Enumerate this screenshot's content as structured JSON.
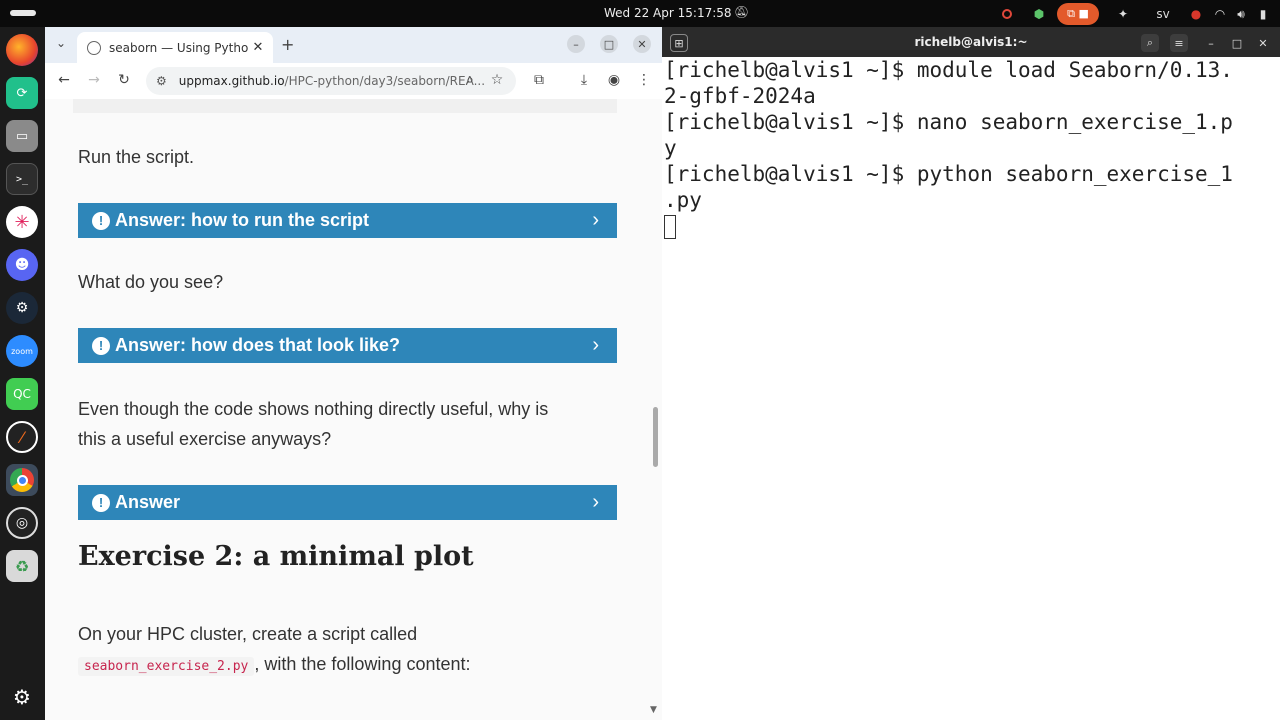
{
  "topbar": {
    "clock": "Wed 22 Apr  15:17:58",
    "keyboard_layout": "sv"
  },
  "dock": {
    "apps": [
      "firefox-icon",
      "pycharm-icon",
      "files-icon",
      "terminal-icon",
      "slack-icon",
      "discord-icon",
      "steam-icon",
      "zoom-icon",
      "qt-creator-icon",
      "pdf-icon",
      "chrome-icon",
      "obs-icon",
      "trash-icon",
      "apps-grid-icon"
    ],
    "zoom_label": "zoom",
    "qt_label": "QC"
  },
  "browser": {
    "tab_title": "seaborn — Using Python",
    "url_host": "uppmax.github.io",
    "url_path": "/HPC-python/day3/seaborn/REA..."
  },
  "page": {
    "para1": "Run the script.",
    "admon1": "Answer: how to run the script",
    "para2": "What do you see?",
    "admon2": "Answer: how does that look like?",
    "para3_line1": "Even though the code shows nothing directly useful, why is",
    "para3_line2": "this a useful exercise anyways?",
    "admon3": "Answer",
    "heading": "Exercise 2: a minimal plot",
    "para4_line1": "On your HPC cluster, create a script called",
    "para4_code": "seaborn_exercise_2.py",
    "para4_rest": ", with the following content:"
  },
  "terminal": {
    "title": "richelb@alvis1:~",
    "lines": [
      "[richelb@alvis1 ~]$ module load Seaborn/0.13.",
      "2-gfbf-2024a",
      "[richelb@alvis1 ~]$ nano seaborn_exercise_1.p",
      "y",
      "[richelb@alvis1 ~]$ python seaborn_exercise_1",
      ".py"
    ]
  },
  "colors": {
    "admonition": "#2e86b9",
    "terminal_bg": "#ffffff",
    "topbar_bg": "#0b0b0b"
  }
}
